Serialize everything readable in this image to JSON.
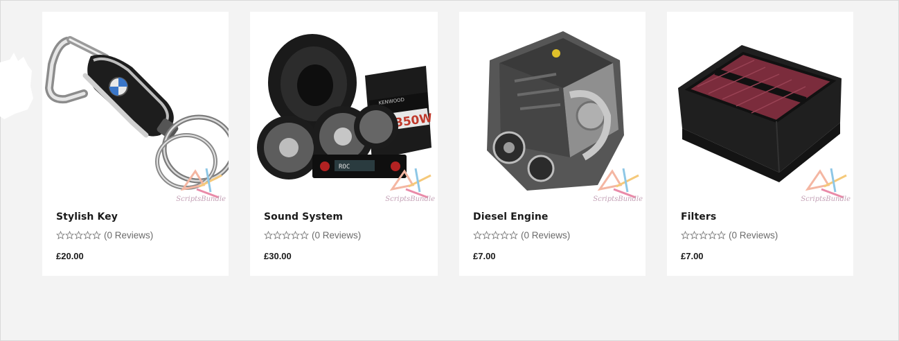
{
  "products": [
    {
      "name": "Stylish Key",
      "reviews": "(0 Reviews)",
      "price": "£20.00",
      "rating": 0,
      "image_icon": "key-fob-image",
      "watermark": "ScriptsBundle"
    },
    {
      "name": "Sound System",
      "reviews": "(0 Reviews)",
      "price": "£30.00",
      "rating": 0,
      "image_icon": "sound-system-image",
      "watermark": "ScriptsBundle"
    },
    {
      "name": "Diesel Engine",
      "reviews": "(0 Reviews)",
      "price": "£7.00",
      "rating": 0,
      "image_icon": "engine-image",
      "watermark": "ScriptsBundle"
    },
    {
      "name": "Filters",
      "reviews": "(0 Reviews)",
      "price": "£7.00",
      "rating": 0,
      "image_icon": "air-filter-image",
      "watermark": "ScriptsBundle"
    }
  ],
  "product_labels": {
    "amp_brand": "KENWOOD",
    "amp_model": "350W",
    "head_unit_display": "ROC"
  },
  "colors": {
    "page_bg": "#f3f3f3",
    "card_bg": "#ffffff",
    "title_text": "#1a1a1a",
    "muted_text": "#6b6b6b"
  }
}
